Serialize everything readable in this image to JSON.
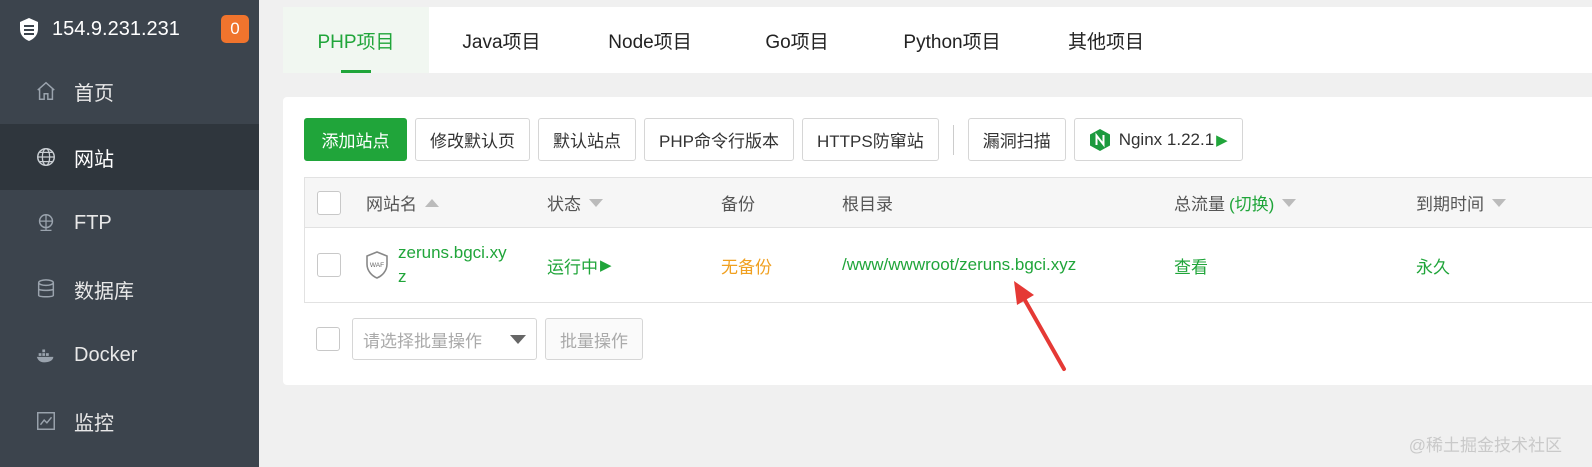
{
  "sidebar": {
    "server_ip": "154.9.231.231",
    "badge_count": "0",
    "items": [
      {
        "label": "首页",
        "icon": "home-icon"
      },
      {
        "label": "网站",
        "icon": "globe-icon",
        "active": true
      },
      {
        "label": "FTP",
        "icon": "ftp-icon"
      },
      {
        "label": "数据库",
        "icon": "database-icon"
      },
      {
        "label": "Docker",
        "icon": "docker-icon"
      },
      {
        "label": "监控",
        "icon": "monitor-icon"
      }
    ]
  },
  "tabs": [
    "PHP项目",
    "Java项目",
    "Node项目",
    "Go项目",
    "Python项目",
    "其他项目"
  ],
  "toolbar": {
    "add_site": "添加站点",
    "modify_default_page": "修改默认页",
    "default_site": "默认站点",
    "php_cli_version": "PHP命令行版本",
    "https_protection": "HTTPS防窜站",
    "vuln_scan": "漏洞扫描",
    "nginx_version": "Nginx 1.22.1"
  },
  "table": {
    "headers": {
      "site_name": "网站名",
      "status": "状态",
      "backup": "备份",
      "root_dir": "根目录",
      "traffic": "总流量",
      "traffic_switch": "(切换)",
      "expire": "到期时间"
    },
    "rows": [
      {
        "site_name_line1": "zeruns.bgci.xy",
        "site_name_line2": "z",
        "waf_label": "WAF",
        "status": "运行中",
        "backup": "无备份",
        "root_dir": "/www/wwwroot/zeruns.bgci.xyz",
        "traffic": "查看",
        "expire": "永久"
      }
    ]
  },
  "footer": {
    "batch_select_placeholder": "请选择批量操作",
    "batch_button": "批量操作"
  },
  "watermark": "@稀土掘金技术社区",
  "colors": {
    "accent": "#20a53a",
    "sidebar_bg": "#3c444d",
    "badge": "#f0742d",
    "backup_warning": "#f0a020",
    "annotation_arrow": "#e53935"
  }
}
